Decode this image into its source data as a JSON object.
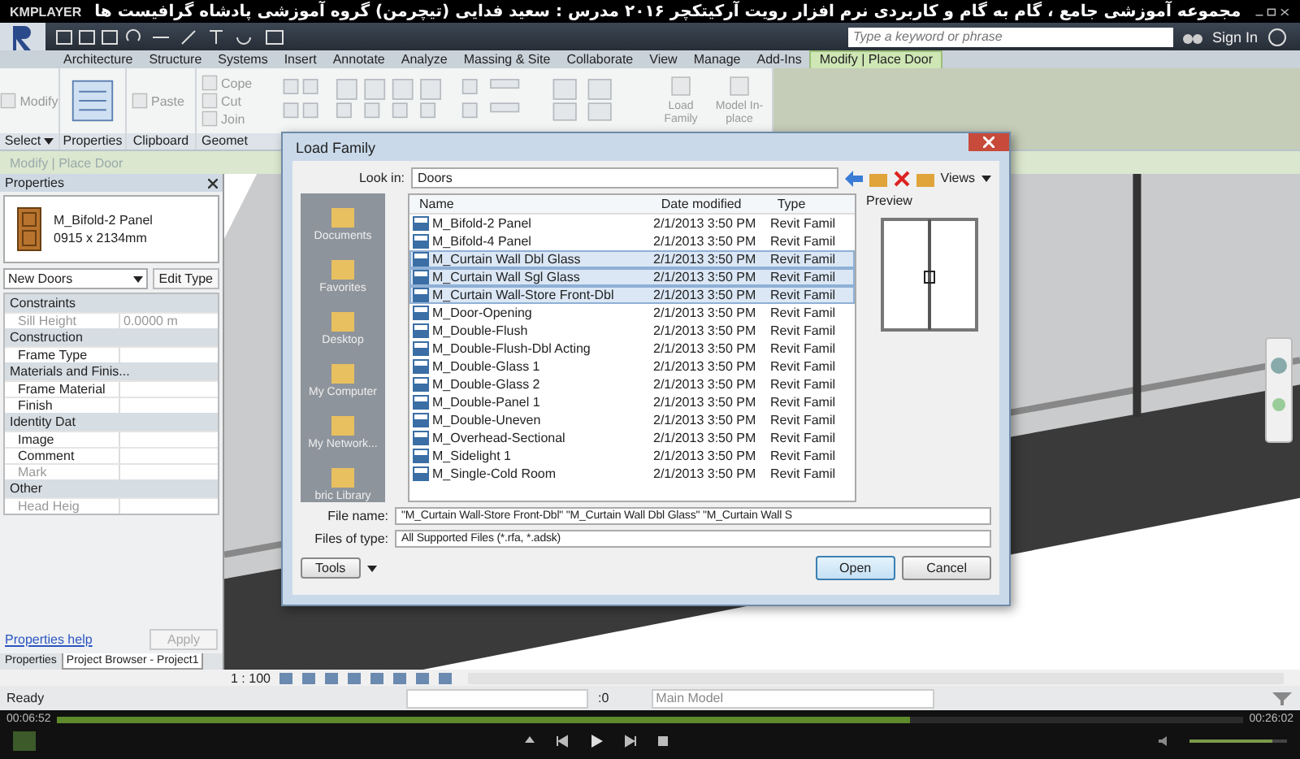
{
  "player": {
    "brand": "KMPLAYER",
    "title": "مجموعه آموزشی جامع ، گام به گام و کاربردی نرم افزار رویت آرکیتکچر ۲۰۱۶   مدرس : سعید فدایی (تیچرمن) گروه آموزشی پادشاه گرافیست ها",
    "elapsed": "00:06:52",
    "total": "00:26:02",
    "progress": {
      "level": 0.72
    },
    "volume": {
      "level": 0.85
    }
  },
  "toolbar": {
    "search": {
      "placeholder": "Type a keyword or phrase"
    },
    "sign_in": "Sign In"
  },
  "tabs": [
    {
      "label": "Architecture",
      "selected": false
    },
    {
      "label": "Structure",
      "selected": false
    },
    {
      "label": "Systems",
      "selected": false
    },
    {
      "label": "Insert",
      "selected": false
    },
    {
      "label": "Annotate",
      "selected": false
    },
    {
      "label": "Analyze",
      "selected": false
    },
    {
      "label": "Massing & Site",
      "selected": false
    },
    {
      "label": "Collaborate",
      "selected": false
    },
    {
      "label": "View",
      "selected": false
    },
    {
      "label": "Manage",
      "selected": false
    },
    {
      "label": "Add-Ins",
      "selected": false
    },
    {
      "label": "Modify | Place Door",
      "selected": true
    }
  ],
  "ribbon": {
    "panels": [
      {
        "label": "Select",
        "kind": "menu",
        "tools": [
          "Modify"
        ]
      },
      {
        "label": "Properties",
        "kind": "plain"
      },
      {
        "label": "Clipboard",
        "kind": "plain",
        "tools": [
          "Paste"
        ]
      },
      {
        "label": "Geomet",
        "kind": "plain",
        "tools": [
          "Cope",
          "Cut",
          "Join"
        ]
      }
    ],
    "family_tools": [
      "Load Family",
      "Model In-place"
    ]
  },
  "options_bar": "Modify | Place Door",
  "properties": {
    "title": "Properties",
    "type_name": "M_Bifold-2 Panel",
    "type_size": "0915 x 2134mm",
    "instance": "New Doors",
    "edit_type": "Edit Type",
    "groups": [
      {
        "name": "Constraints",
        "rows": [
          {
            "label": "Sill Height",
            "value": "0.0000 m",
            "disabled": true
          }
        ]
      },
      {
        "name": "Construction",
        "rows": [
          {
            "label": "Frame Type",
            "value": "",
            "disabled": false
          }
        ]
      },
      {
        "name": "Materials and Finis...",
        "rows": [
          {
            "label": "Frame Material",
            "value": "",
            "disabled": false
          },
          {
            "label": "Finish",
            "value": "",
            "disabled": false
          }
        ]
      },
      {
        "name": "Identity Dat",
        "rows": [
          {
            "label": "Image",
            "value": "",
            "disabled": false
          },
          {
            "label": "Comment",
            "value": "",
            "disabled": false
          },
          {
            "label": "Mark",
            "value": "",
            "disabled": true
          }
        ]
      },
      {
        "name": "Other",
        "rows": [
          {
            "label": "Head Heig",
            "value": "",
            "disabled": true
          }
        ]
      }
    ],
    "help": "Properties help",
    "apply": {
      "label": "Apply",
      "disabled": true
    },
    "tabs": [
      {
        "label": "Properties",
        "selected": false
      },
      {
        "label": "Project Browser - Project1",
        "selected": true
      }
    ]
  },
  "dialog": {
    "title": "Load Family",
    "look_in_label": "Look in:",
    "look_in": "Doors",
    "views": "Views",
    "preview_label": "Preview",
    "places": [
      "Documents",
      "Favorites",
      "Desktop",
      "My Computer",
      "My Network...",
      "bric Library"
    ],
    "columns": [
      "Name",
      "Date modified",
      "Type"
    ],
    "files": [
      {
        "name": "M_Bifold-2 Panel",
        "date": "2/1/2013 3:50 PM",
        "type": "Revit Famil",
        "selected": false
      },
      {
        "name": "M_Bifold-4 Panel",
        "date": "2/1/2013 3:50 PM",
        "type": "Revit Famil",
        "selected": false
      },
      {
        "name": "M_Curtain Wall Dbl Glass",
        "date": "2/1/2013 3:50 PM",
        "type": "Revit Famil",
        "selected": true
      },
      {
        "name": "M_Curtain Wall Sgl Glass",
        "date": "2/1/2013 3:50 PM",
        "type": "Revit Famil",
        "selected": true
      },
      {
        "name": "M_Curtain Wall-Store Front-Dbl",
        "date": "2/1/2013 3:50 PM",
        "type": "Revit Famil",
        "selected": true
      },
      {
        "name": "M_Door-Opening",
        "date": "2/1/2013 3:50 PM",
        "type": "Revit Famil",
        "selected": false
      },
      {
        "name": "M_Double-Flush",
        "date": "2/1/2013 3:50 PM",
        "type": "Revit Famil",
        "selected": false
      },
      {
        "name": "M_Double-Flush-Dbl Acting",
        "date": "2/1/2013 3:50 PM",
        "type": "Revit Famil",
        "selected": false
      },
      {
        "name": "M_Double-Glass 1",
        "date": "2/1/2013 3:50 PM",
        "type": "Revit Famil",
        "selected": false
      },
      {
        "name": "M_Double-Glass 2",
        "date": "2/1/2013 3:50 PM",
        "type": "Revit Famil",
        "selected": false
      },
      {
        "name": "M_Double-Panel 1",
        "date": "2/1/2013 3:50 PM",
        "type": "Revit Famil",
        "selected": false
      },
      {
        "name": "M_Double-Uneven",
        "date": "2/1/2013 3:50 PM",
        "type": "Revit Famil",
        "selected": false
      },
      {
        "name": "M_Overhead-Sectional",
        "date": "2/1/2013 3:50 PM",
        "type": "Revit Famil",
        "selected": false
      },
      {
        "name": "M_Sidelight 1",
        "date": "2/1/2013 3:50 PM",
        "type": "Revit Famil",
        "selected": false
      },
      {
        "name": "M_Single-Cold Room",
        "date": "2/1/2013 3:50 PM",
        "type": "Revit Famil",
        "selected": false
      }
    ],
    "file_name_label": "File name:",
    "file_name": "\"M_Curtain Wall-Store Front-Dbl\" \"M_Curtain Wall Dbl Glass\" \"M_Curtain Wall S",
    "file_type_label": "Files of type:",
    "file_type": "All Supported Files  (*.rfa, *.adsk)",
    "tools": "Tools",
    "open": "Open",
    "cancel": "Cancel"
  },
  "view_bar": {
    "scale": "1 : 100"
  },
  "status_bar": {
    "message": "Ready",
    "count": ":0",
    "workset": "Main Model"
  }
}
